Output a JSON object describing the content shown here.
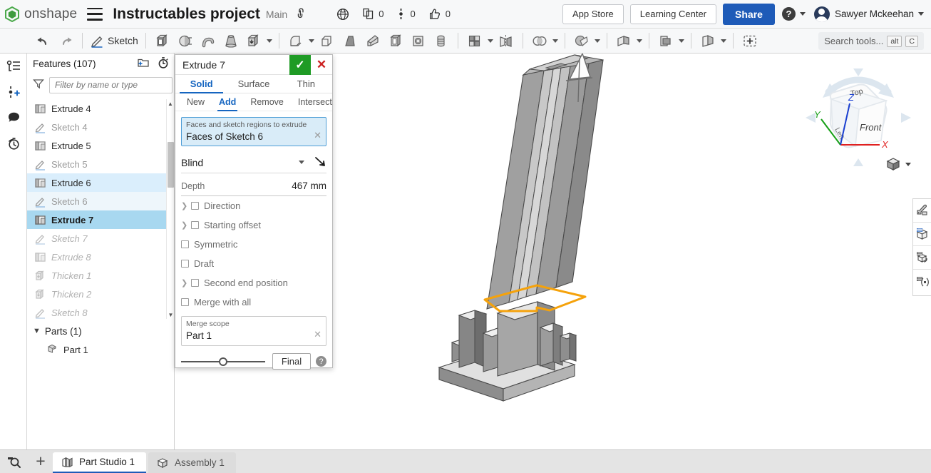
{
  "header": {
    "brand": "onshape",
    "menu_icon": "hamburger-icon",
    "doc_title": "Instructables project",
    "branch": "Main",
    "link_icon": "link-icon",
    "globe_icon": "globe-icon",
    "copies_count": "0",
    "versions_count": "0",
    "likes_count": "0",
    "app_store": "App Store",
    "learning_center": "Learning Center",
    "share": "Share",
    "help": "?",
    "user_name": "Sawyer Mckeehan"
  },
  "toolbar": {
    "undo": "undo-icon",
    "redo": "redo-icon",
    "sketch_label": "Sketch",
    "search_placeholder": "Search tools...",
    "kbd_alt": "alt",
    "kbd_c": "C",
    "tools": [
      "extrude-icon",
      "revolve-icon",
      "sweep-icon",
      "loft-icon",
      "thicken-icon",
      "fillet-icon",
      "chamfer-icon",
      "draft-icon",
      "rib-icon",
      "shell-icon",
      "hole-icon",
      "thread-icon",
      "pattern-icon",
      "mirror-icon",
      "transform-icon",
      "boolean-icon",
      "split-icon",
      "plane-icon",
      "derive-icon",
      "assign-variable-icon",
      "add-custom-feature-icon"
    ]
  },
  "left_rail": {
    "items": [
      {
        "icon": "feature-list-icon",
        "name": "feature-list"
      },
      {
        "icon": "add-version-icon",
        "name": "add-version"
      },
      {
        "icon": "comment-icon",
        "name": "comments"
      },
      {
        "icon": "history-icon",
        "name": "history"
      }
    ]
  },
  "features_panel": {
    "title": "Features (107)",
    "add_folder_icon": "add-folder-icon",
    "rollback_icon": "rollback-timer-icon",
    "filter_icon": "funnel-icon",
    "filter_placeholder": "Filter by name or type",
    "items": [
      {
        "label": "Extrude 4",
        "icon": "extrude-feature-icon",
        "state": "normal"
      },
      {
        "label": "Sketch 4",
        "icon": "sketch-feature-icon",
        "state": "dim"
      },
      {
        "label": "Extrude 5",
        "icon": "extrude-feature-icon",
        "state": "normal"
      },
      {
        "label": "Sketch 5",
        "icon": "sketch-feature-icon",
        "state": "dim"
      },
      {
        "label": "Extrude 6",
        "icon": "extrude-feature-icon",
        "state": "selected-light"
      },
      {
        "label": "Sketch 6",
        "icon": "sketch-feature-icon",
        "state": "selected-light2"
      },
      {
        "label": "Extrude 7",
        "icon": "extrude-feature-icon",
        "state": "selected-strong"
      },
      {
        "label": "Sketch 7",
        "icon": "sketch-feature-icon",
        "state": "rolled"
      },
      {
        "label": "Extrude 8",
        "icon": "extrude-feature-icon",
        "state": "rolled"
      },
      {
        "label": "Thicken 1",
        "icon": "thicken-feature-icon",
        "state": "rolled"
      },
      {
        "label": "Thicken 2",
        "icon": "thicken-feature-icon",
        "state": "rolled"
      },
      {
        "label": "Sketch 8",
        "icon": "sketch-feature-icon",
        "state": "rolled"
      }
    ],
    "parts_header": "Parts (1)",
    "parts": [
      {
        "label": "Part 1",
        "icon": "part-icon"
      }
    ]
  },
  "dialog": {
    "title": "Extrude 7",
    "accept_icon": "checkmark-icon",
    "cancel_icon": "close-icon",
    "type_tabs": [
      {
        "label": "Solid",
        "active": true
      },
      {
        "label": "Surface",
        "active": false
      },
      {
        "label": "Thin",
        "active": false
      }
    ],
    "op_tabs": [
      {
        "label": "New",
        "active": false
      },
      {
        "label": "Add",
        "active": true
      },
      {
        "label": "Remove",
        "active": false
      },
      {
        "label": "Intersect",
        "active": false
      }
    ],
    "selection": {
      "caption": "Faces and sketch regions to extrude",
      "value": "Faces of Sketch 6",
      "clear_icon": "clear-x-icon"
    },
    "end_condition": "Blind",
    "flip_icon": "flip-direction-icon",
    "depth_label": "Depth",
    "depth_value": "467 mm",
    "options": [
      {
        "label": "Direction",
        "checked": false,
        "expandable": true
      },
      {
        "label": "Starting offset",
        "checked": false,
        "expandable": true
      },
      {
        "label": "Symmetric",
        "checked": false,
        "expandable": false
      },
      {
        "label": "Draft",
        "checked": false,
        "expandable": false
      },
      {
        "label": "Second end position",
        "checked": false,
        "expandable": true
      },
      {
        "label": "Merge with all",
        "checked": false,
        "expandable": false
      }
    ],
    "merge_scope": {
      "caption": "Merge scope",
      "value": "Part 1",
      "clear_icon": "clear-x-icon"
    },
    "final_button": "Final",
    "help_icon": "question-mark-icon"
  },
  "viewcube": {
    "top_face": "Top",
    "front_face": "Front",
    "left_face": "Left",
    "axis_x": "X",
    "axis_y": "Y",
    "axis_z": "Z",
    "view_button_icon": "view-orientation-cube-icon"
  },
  "right_strip": {
    "items": [
      {
        "icon": "appearance-icon",
        "name": "render-appearance"
      },
      {
        "icon": "display-cube-icon",
        "name": "display-state"
      },
      {
        "icon": "rotate-cube-icon",
        "name": "rotate-view"
      },
      {
        "icon": "section-cube-icon",
        "name": "section-view"
      }
    ]
  },
  "bottom": {
    "search_icon": "zoom-search-icon",
    "add_tab": "+",
    "tabs": [
      {
        "label": "Part Studio 1",
        "icon": "part-studio-icon",
        "active": true
      },
      {
        "label": "Assembly 1",
        "icon": "assembly-icon",
        "active": false
      }
    ]
  },
  "colors": {
    "accent_blue": "#1565c0",
    "share_blue": "#1e5bb8",
    "ok_green": "#1f9b25",
    "cancel_red": "#cc2020",
    "highlight_orange": "#f5a20b",
    "selection_blue": "#a8d8f0",
    "model_gray": "#9e9e9e"
  }
}
